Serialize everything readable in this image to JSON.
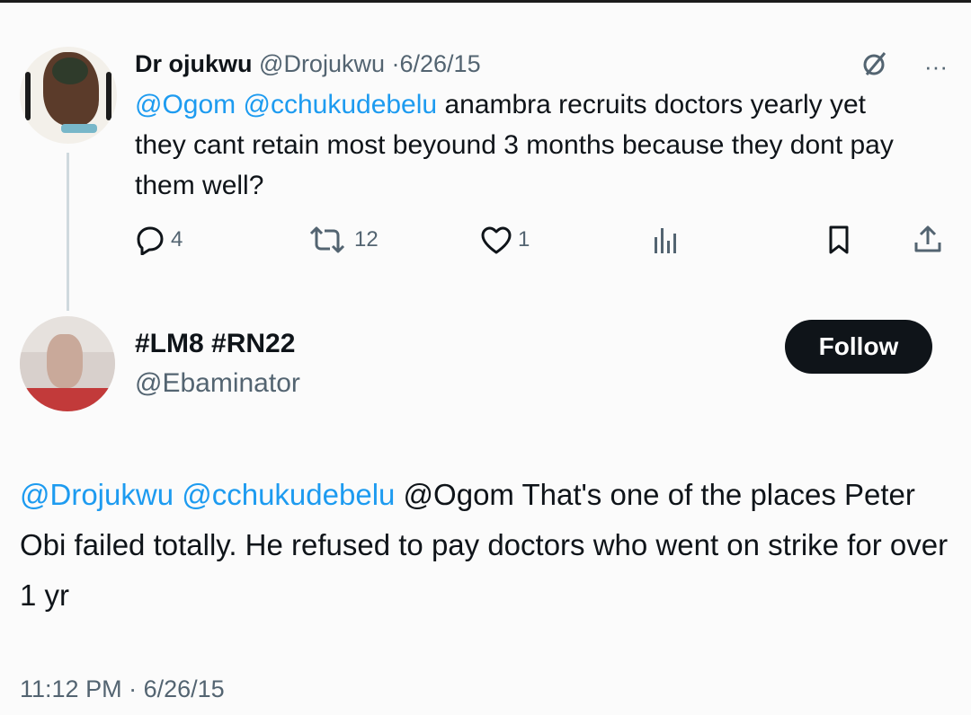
{
  "tweet1": {
    "display_name": "Dr ojukwu",
    "handle": "@Drojukwu",
    "separator": "·",
    "date": "6/26/15",
    "text_mentions": [
      "@Ogom",
      "@cchukudebelu"
    ],
    "text_body": " anambra recruits doctors yearly yet they cant retain most beyound 3 months because they dont pay them well?",
    "more_label": "···",
    "actions": {
      "replies": "4",
      "retweets": "12",
      "likes": "1",
      "views": ""
    },
    "icons": [
      "grok-icon",
      "more-icon",
      "reply-icon",
      "retweet-icon",
      "like-icon",
      "views-icon",
      "bookmark-icon",
      "share-icon"
    ]
  },
  "tweet2": {
    "display_name": "#LM8 #RN22",
    "handle": "@Ebaminator",
    "follow_label": "Follow",
    "text_mentions": [
      "@Drojukwu",
      "@cchukudebelu"
    ],
    "text_body": " @Ogom That's one of the places Peter Obi failed totally. He refused to pay doctors who went on strike for over 1 yr",
    "time": "11:12 PM",
    "separator": "·",
    "date": "6/26/15"
  },
  "colors": {
    "accent": "#1d9bf0",
    "muted": "#536471",
    "text": "#0f1419"
  }
}
